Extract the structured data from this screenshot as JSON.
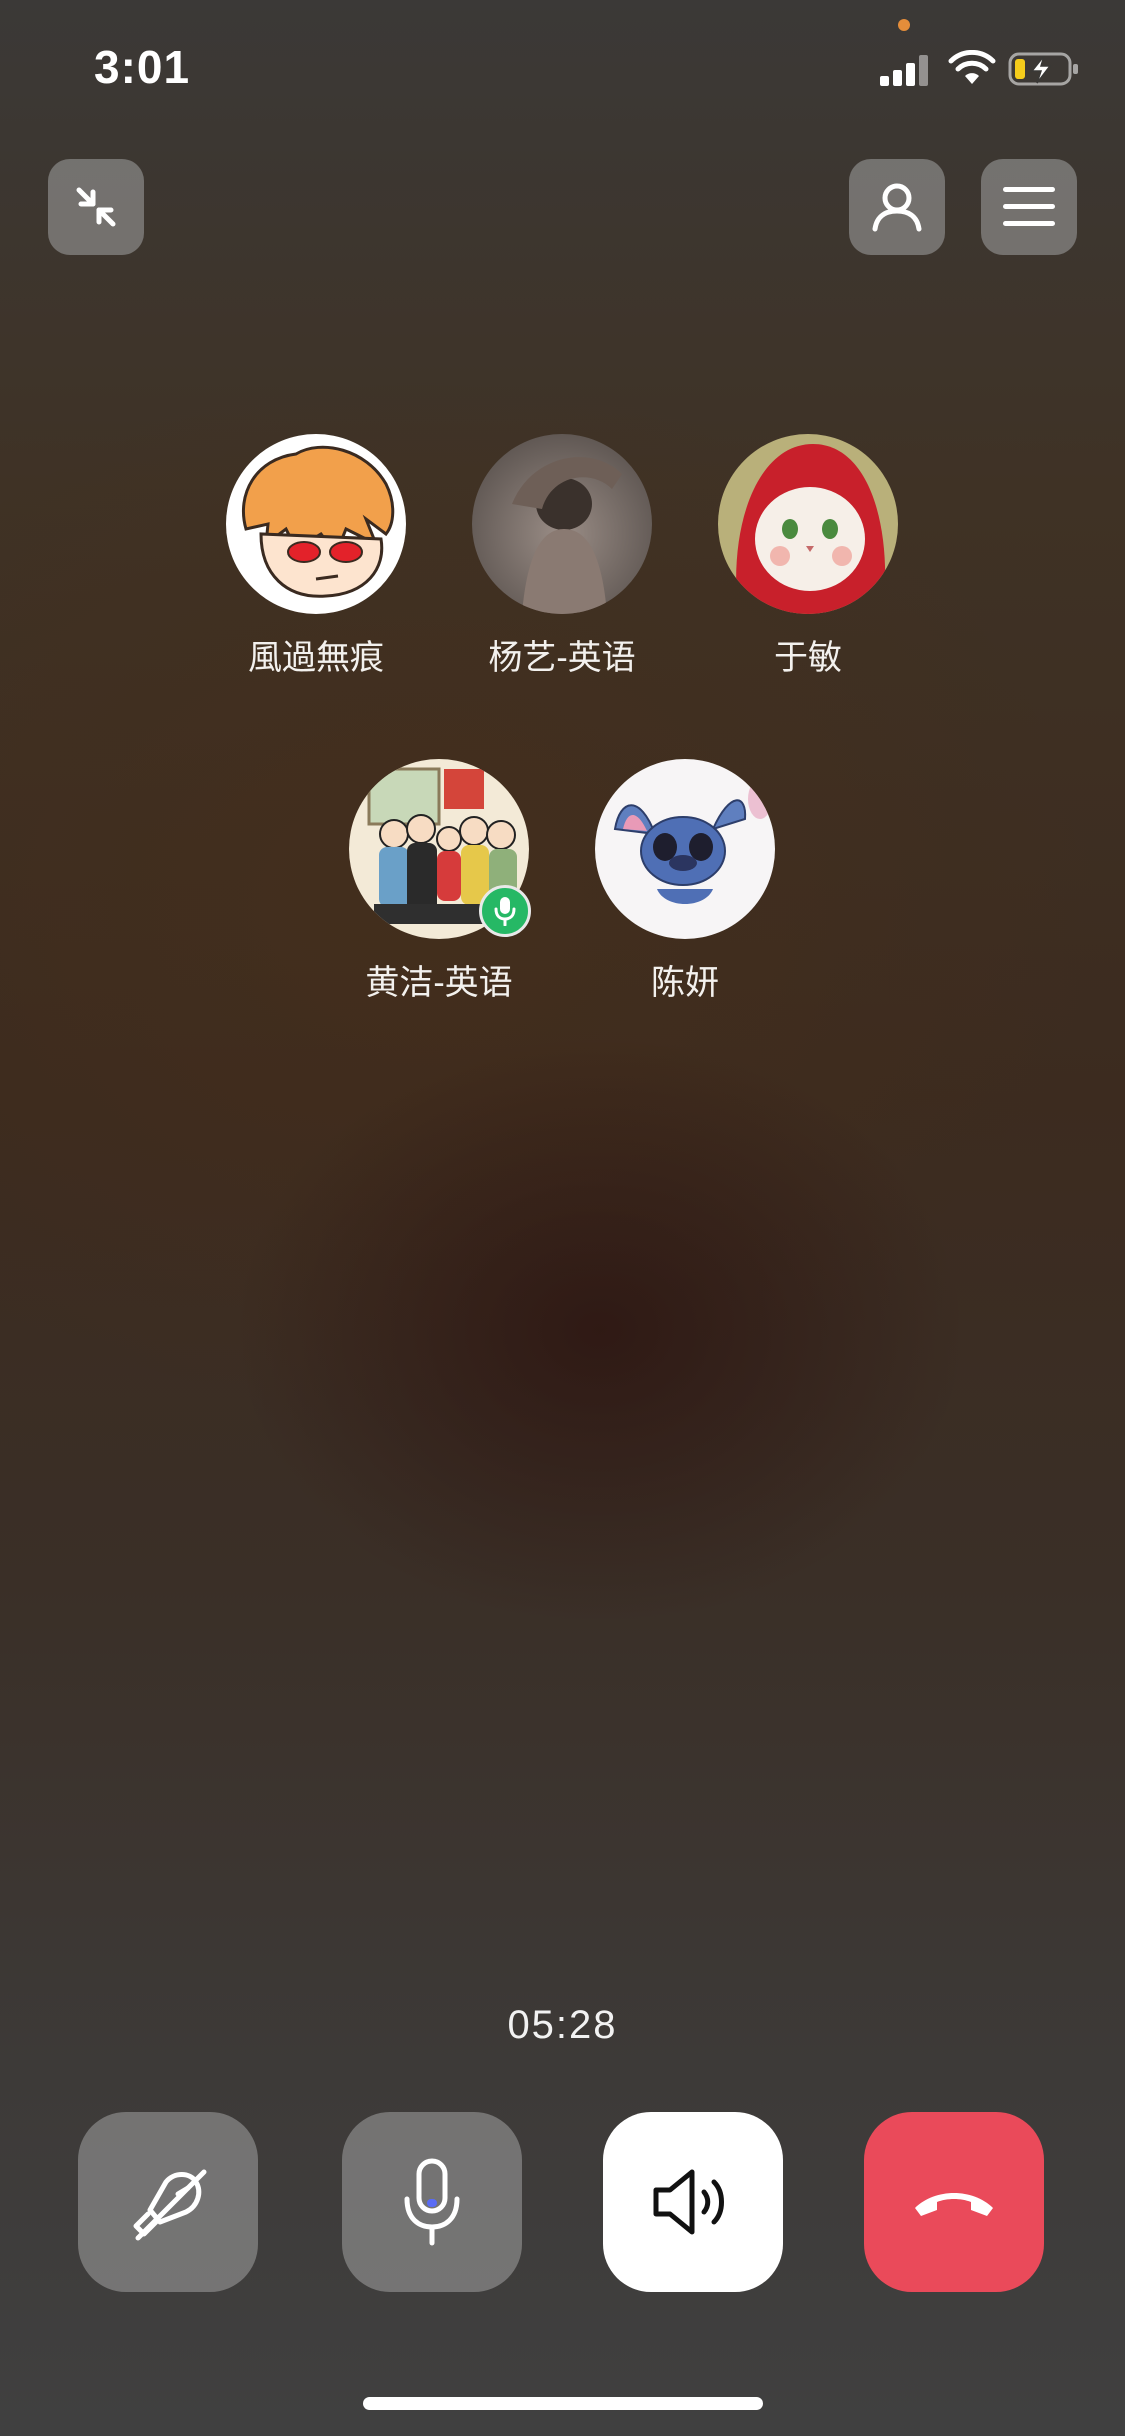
{
  "status_bar": {
    "time": "3:01",
    "icons": [
      "privacy-indicator-dot",
      "cellular-signal-icon",
      "wifi-icon",
      "battery-charging-icon"
    ],
    "privacy_dot_color": "#e48d3a",
    "battery_color": "#f5cc1b"
  },
  "top_bar": {
    "minimize_icon": "collapse-arrows-icon",
    "add_member_icon": "person-icon",
    "menu_icon": "hamburger-menu-icon"
  },
  "participants": [
    {
      "name": "風過無痕",
      "avatar": "anime-character-avatar",
      "speaking": false
    },
    {
      "name": "杨艺-英语",
      "avatar": "photo-avatar",
      "speaking": false
    },
    {
      "name": "于敏",
      "avatar": "cat-avatar",
      "speaking": false
    },
    {
      "name": "黄洁-英语",
      "avatar": "family-cartoon-avatar",
      "speaking": true
    },
    {
      "name": "陈妍",
      "avatar": "stitch-avatar",
      "speaking": false
    }
  ],
  "call": {
    "timer": "05:28"
  },
  "controls": [
    {
      "name": "camera-off",
      "icon": "camera-off-icon",
      "state": "off"
    },
    {
      "name": "microphone",
      "icon": "microphone-icon",
      "state": "on"
    },
    {
      "name": "speaker",
      "icon": "speaker-icon",
      "state": "on"
    },
    {
      "name": "hang-up",
      "icon": "hang-up-icon"
    }
  ],
  "colors": {
    "speaking_badge": "#26b865",
    "hangup": "#ea4a5a",
    "control_grey": "#969696"
  }
}
